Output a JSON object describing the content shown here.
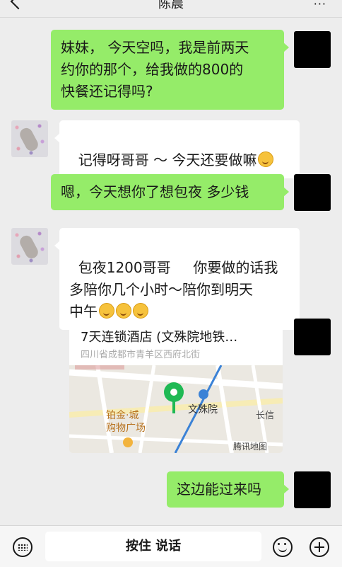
{
  "header": {
    "title": "陈晨",
    "more_label": "···"
  },
  "messages": [
    {
      "side": "right",
      "text": "妹妹， 今天空吗，我是前两天\n约你的那个，给我做的800的\n快餐还记得吗?"
    },
    {
      "side": "left",
      "text": "记得呀哥哥 ～ 今天还要做嘛"
    },
    {
      "side": "right",
      "text": "嗯，今天想你了想包夜 多少钱"
    },
    {
      "side": "left",
      "text": "包夜1200哥哥     你要做的话我\n多陪你几个小时～陪你到明天\n中午"
    },
    {
      "side": "right",
      "type": "location"
    },
    {
      "side": "right",
      "text": "这边能过来吗"
    }
  ],
  "location": {
    "title": "7天连锁酒店 (文殊院地铁…",
    "address": "四川省成都市青羊区西府北街",
    "map_labels": {
      "station": "文殊院",
      "mall": "铂金·城\n购物广场",
      "side_label": "长信",
      "provider": "腾讯地图"
    }
  },
  "input": {
    "voice_label": "按住 说话"
  },
  "colors": {
    "sent_bubble": "#95ec69",
    "received_bubble": "#ffffff",
    "background": "#ededed"
  },
  "icons": [
    "back-icon",
    "more-icon",
    "keyboard-icon",
    "emoji-icon",
    "plus-icon",
    "map-pin-icon",
    "metro-icon"
  ]
}
